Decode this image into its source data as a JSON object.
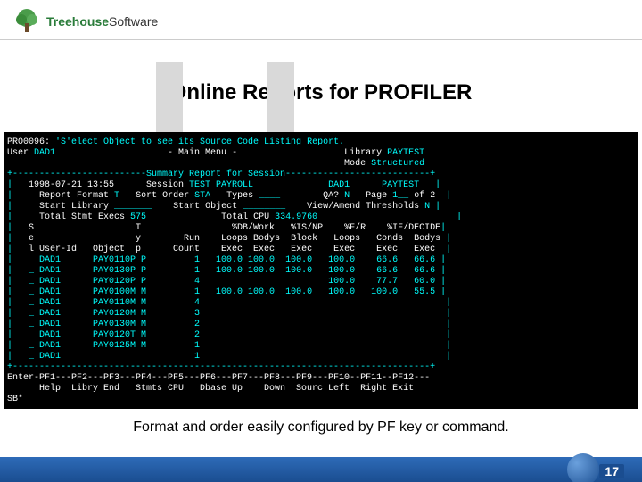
{
  "logo": {
    "company": "Treehouse",
    "suffix": "Software"
  },
  "title": "Online Reports for PROFILER",
  "term": {
    "msgid": "PRO0096:",
    "msg": " 'S'elect Object to see its Source Code Listing Report.",
    "user_lbl": "User",
    "user": " DAD1",
    "menu": "                     - Main Menu -",
    "library_lbl": "                    Library",
    "library": " PAYTEST",
    "mode_lbl": "                                                               Mode",
    "mode": " Structured",
    "boxtop": "+-------------------------Summary Report for Session---------------------------+",
    "sess_date": "  1998-07-21 13:55      Session",
    "sess_name": " TEST PAYROLL",
    "sess_right": "              DAD1      PAYTEST   ",
    "fmt_lbl": "    Report Format",
    "fmt": " T",
    "sort_lbl": "   Sort Order",
    "sort": " STA",
    "types_lbl": "   Types ",
    "types": "____",
    "qa_lbl": "        QA?",
    "qa": " N",
    "pg_lbl": "   Page",
    "pg": " 1__",
    "pg_of": " of 2  ",
    "start_lib_lbl": "    Start Library ",
    "start_lib": "_______",
    "start_obj_lbl": "    Start Object ",
    "start_obj": "________",
    "thresh_lbl": "    View/Amend Thresholds",
    "thresh": " N ",
    "tse_lbl": "    Total Stmt Execs",
    "tse": " 575",
    "tcpu_lbl": "              Total CPU",
    "tcpu": " 334.9760",
    "hdr1": "  S                   T                 %DB/Work   %IS/NP    %F/R    %IF/DECIDE",
    "hdr2": "  e                   y        Run    Loops Bodys  Block   Loops   Conds  Bodys ",
    "hdr3": "  l User-Id   Object  p      Count    Exec  Exec   Exec    Exec    Exec   Exec  ",
    "rows": [
      "  _ DAD1      PAY0110P P         1   100.0 100.0  100.0   100.0    66.6   66.6 ",
      "  _ DAD1      PAY0130P P         1   100.0 100.0  100.0   100.0    66.6   66.6 ",
      "  _ DAD1      PAY0120P P         4                        100.0    77.7   60.0 ",
      "  _ DAD1      PAY0100M M         1   100.0 100.0  100.0   100.0   100.0   55.5 ",
      "  _ DAD1      PAY0110M M         4                                              ",
      "  _ DAD1      PAY0120M M         3                                              ",
      "  _ DAD1      PAY0130M M         2                                              ",
      "  _ DAD1      PAY0120T M         2                                              ",
      "  _ DAD1      PAY0125M M         1                                              ",
      "  _ DAD1                         1                                              "
    ],
    "boxbot": "+------------------------------------------------------------------------------+",
    "pfkeys1": "Enter-PF1---PF2---PF3---PF4---PF5---PF6---PF7---PF8---PF9---PF10--PF11--PF12---",
    "pfkeys2": "      Help  Libry End   Stmts CPU   Dbase Up    Down  Sourc Left  Right Exit   ",
    "sb": "SB*"
  },
  "footnote": "Format and order easily configured by PF key or command.",
  "page": "17"
}
